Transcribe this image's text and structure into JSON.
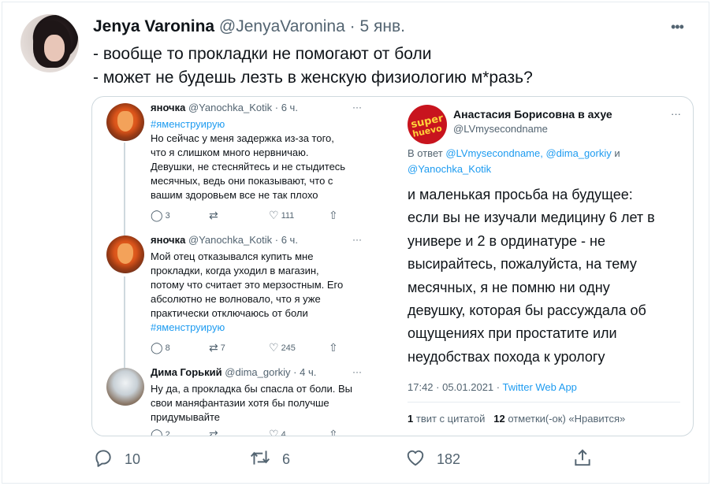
{
  "author": {
    "name": "Jenya Varonina",
    "handle": "@JenyaVaronina",
    "separator": "·",
    "date": "5 янв."
  },
  "more_icon": "•••",
  "tweet_lines": [
    "- вообще то прокладки не помогают от боли",
    "- может не будешь лезть в женскую физиологию м*разь?"
  ],
  "embedded": {
    "left_thread": [
      {
        "name": "яночка",
        "handle": "@Yanochka_Kotik · 6 ч.",
        "text_lines": [
          "Но сейчас у меня задержка из-за того,",
          "что я слишком много нервничаю.",
          "Девушки, не стесняйтесь и не стыдитесь",
          "месячных, ведь они показывают, что с",
          "вашим здоровьем все не так плохо"
        ],
        "hashtag_first": "#яменструирую",
        "hashtag_last": "",
        "replies": "3",
        "retweets": "",
        "likes": "111"
      },
      {
        "name": "яночка",
        "handle": "@Yanochka_Kotik · 6 ч.",
        "text_lines": [
          "Мой отец отказывался купить мне",
          "прокладки, когда уходил в магазин,",
          "потому что считает это мерзостным. Его",
          "абсолютно не волновало, что я уже",
          "практически отключаюсь от боли"
        ],
        "hashtag_first": "",
        "hashtag_last": "#яменструирую",
        "replies": "8",
        "retweets": "7",
        "likes": "245"
      },
      {
        "name": "Дима Горький",
        "handle": "@dima_gorkiy · 4 ч.",
        "text_lines": [
          "Ну да, а прокладка бы спасла от боли. Вы",
          "свои маняфантазии хотя бы получше",
          "придумывайте"
        ],
        "hashtag_first": "",
        "hashtag_last": "",
        "replies": "2",
        "retweets": "",
        "likes": "4"
      }
    ],
    "right_tweet": {
      "logo_text_1": "super",
      "logo_text_2": "huevo",
      "name": "Анастасия Борисовна в ахуе",
      "handle": "@LVmysecondname",
      "reply_prefix": "В ответ",
      "reply_links_1": "@LVmysecondname, @dima_gorkiy",
      "reply_and": "и",
      "reply_links_2": "@Yanochka_Kotik",
      "body_lines": [
        "и маленькая просьба на будущее:",
        "если вы не изучали медицину 6 лет в",
        "универе и 2 в ординатуре - не",
        "высирайтесь, пожалуйста, на тему",
        "месячных, я не помню ни одну",
        "девушку, которая бы рассуждала об",
        "ощущениях при простатите или",
        "неудобствах похода к урологу"
      ],
      "timestamp": "17:42 · 05.01.2021 ·",
      "app": "Twitter Web App",
      "quote_count": "1",
      "quote_label": "твит с цитатой",
      "like_count": "12",
      "like_label": "отметки(-ок) «Нравится»"
    }
  },
  "actions": {
    "replies": "10",
    "retweets": "6",
    "likes": "182"
  },
  "colors": {
    "accent": "#1d9bf0",
    "text": "#0f1419",
    "muted": "#536471",
    "border": "#cfd9de"
  },
  "icons": [
    "reply-icon",
    "retweet-icon",
    "like-icon",
    "share-icon",
    "more-icon"
  ]
}
